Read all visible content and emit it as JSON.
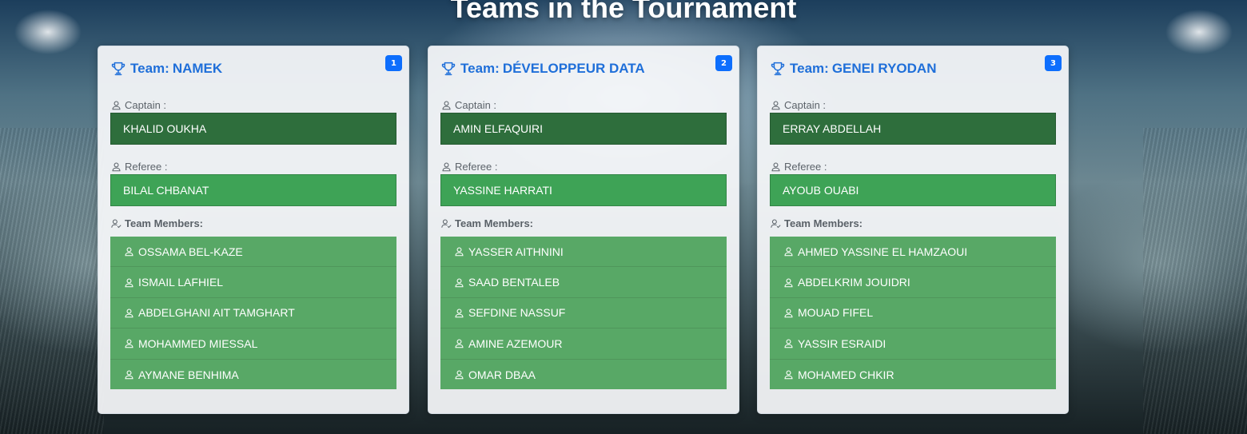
{
  "page": {
    "title": "Teams in the Tournament"
  },
  "teams": [
    {
      "number": "1",
      "team_prefix": "Team:",
      "name": "NAMEK",
      "captain_label": "Captain :",
      "captain": "KHALID OUKHA",
      "referee_label": "Referee :",
      "referee": "BILAL CHBANAT",
      "members_label": "Team Members:",
      "members": [
        "OSSAMA BEL-KAZE",
        "ISMAIL LAFHIEL",
        "ABDELGHANI AIT TAMGHART",
        "MOHAMMED MIESSAL",
        "AYMANE BENHIMA"
      ]
    },
    {
      "number": "2",
      "team_prefix": "Team:",
      "name": "DÉVELOPPEUR DATA",
      "captain_label": "Captain :",
      "captain": "AMIN ELFAQUIRI",
      "referee_label": "Referee :",
      "referee": "YASSINE HARRATI",
      "members_label": "Team Members:",
      "members": [
        "YASSER AITHNINI",
        "SAAD BENTALEB",
        "SEFDINE NASSUF",
        "AMINE AZEMOUR",
        "OMAR DBAA"
      ]
    },
    {
      "number": "3",
      "team_prefix": "Team:",
      "name": "GENEI RYODAN",
      "captain_label": "Captain :",
      "captain": "ERRAY ABDELLAH",
      "referee_label": "Referee :",
      "referee": "AYOUB OUABI",
      "members_label": "Team Members:",
      "members": [
        "AHMED YASSINE EL HAMZAOUI",
        "ABDELKRIM JOUIDRI",
        "MOUAD FIFEL",
        "YASSIR ESRAIDI",
        "MOHAMED CHKIR"
      ]
    }
  ],
  "icons": {
    "team_heading": "trophy-icon",
    "captain": "user-icon",
    "referee": "user-icon",
    "members_heading": "users-check-icon",
    "member": "user-icon"
  },
  "colors": {
    "heading": "#1f6fd9",
    "badge": "#0d6efd",
    "captain_bg": "#2e6e3c",
    "referee_bg": "#3ea356",
    "members_bg": "#58a866"
  }
}
